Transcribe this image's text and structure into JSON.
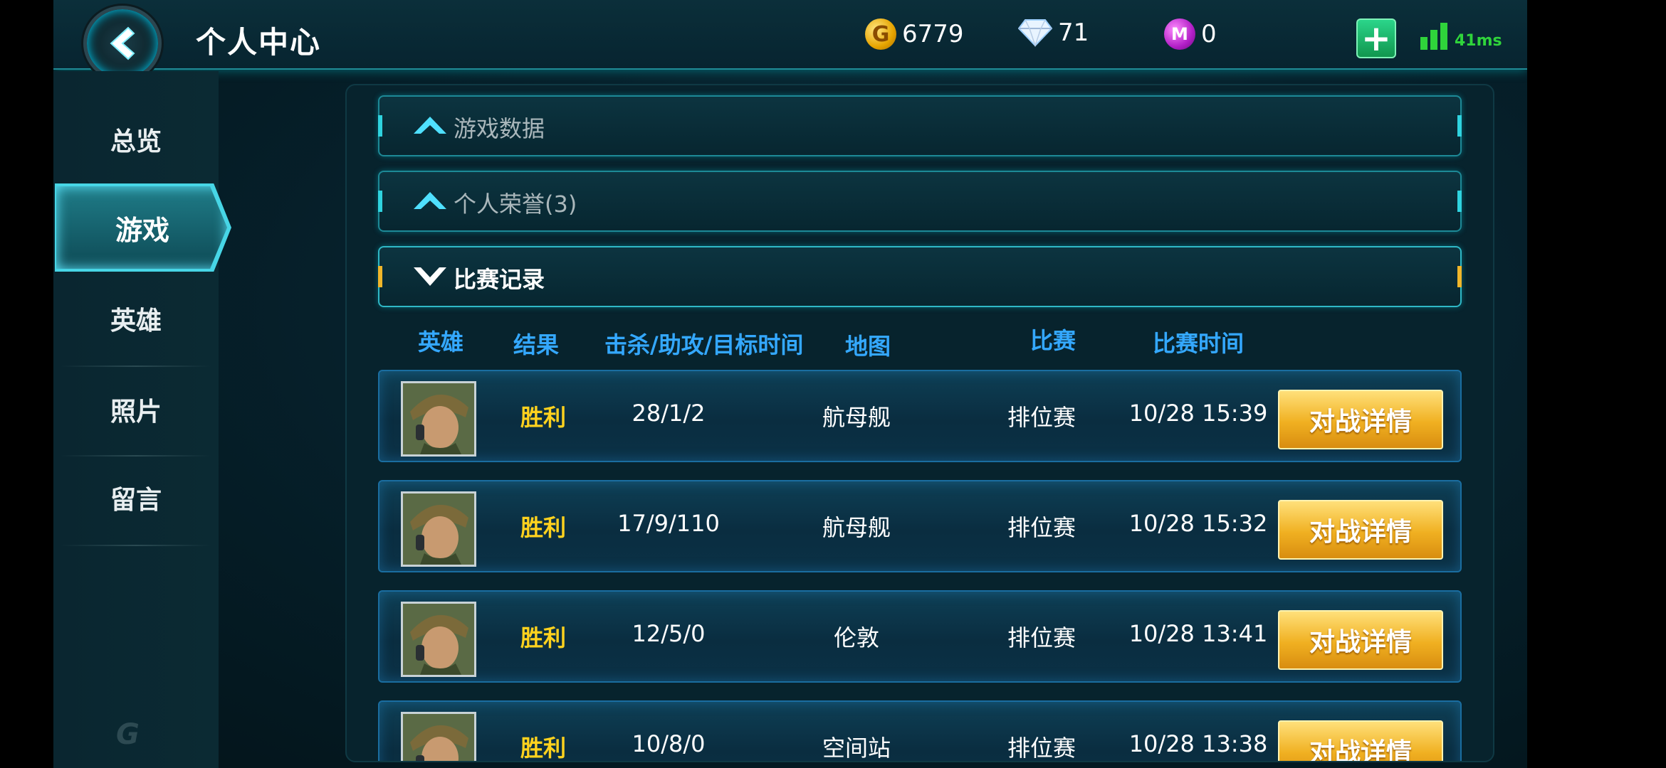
{
  "header": {
    "title": "个人中心",
    "gold": "6779",
    "diamonds": "71",
    "m_coins": "0",
    "ping": "41ms"
  },
  "sidebar": {
    "items": [
      {
        "label": "总览"
      },
      {
        "label": "游戏"
      },
      {
        "label": "英雄"
      },
      {
        "label": "照片"
      },
      {
        "label": "留言"
      }
    ],
    "active": "游戏"
  },
  "sections": [
    {
      "label": "游戏数据",
      "state": "collapsed"
    },
    {
      "label": "个人荣誉(3)",
      "state": "collapsed"
    },
    {
      "label": "比赛记录",
      "state": "expanded"
    }
  ],
  "match_table": {
    "headers": [
      "英雄",
      "结果",
      "击杀/助攻/目标时间",
      "地图",
      "比赛",
      "比赛时间"
    ],
    "rows": [
      {
        "result": "胜利",
        "kda": "28/1/2",
        "map": "航母舰",
        "mode": "排位赛",
        "time": "10/28 15:39",
        "button": "对战详情"
      },
      {
        "result": "胜利",
        "kda": "17/9/110",
        "map": "航母舰",
        "mode": "排位赛",
        "time": "10/28 15:32",
        "button": "对战详情"
      },
      {
        "result": "胜利",
        "kda": "12/5/0",
        "map": "伦敦",
        "mode": "排位赛",
        "time": "10/28 13:41",
        "button": "对战详情"
      },
      {
        "result": "胜利",
        "kda": "10/8/0",
        "map": "空间站",
        "mode": "排位赛",
        "time": "10/28 13:38",
        "button": "对战详情"
      }
    ]
  }
}
